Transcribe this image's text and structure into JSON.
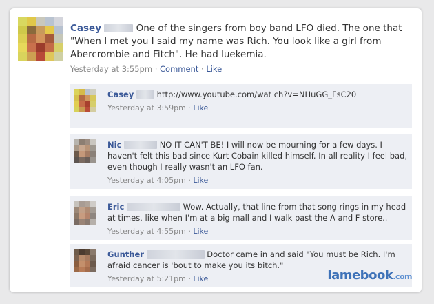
{
  "post": {
    "author": "Casey",
    "text": "One of the singers from boy band LFO died. The one that \"When I met you I said my name was Rich. You look like a girl from Abercrombie and Fitch\". He had luekemia.",
    "timestamp": "Yesterday at 3:55pm",
    "comment_label": "Comment",
    "like_label": "Like",
    "separator": "·"
  },
  "comments": [
    {
      "author": "Casey",
      "text": "http://www.youtube.com/wat ch?v=NHuGG_FsC20",
      "timestamp": "Yesterday at 3:59pm",
      "like_label": "Like"
    },
    {
      "author": "Nic",
      "text": "NO IT CAN'T BE! I will now be mourning for a few days. I haven't felt this bad since Kurt Cobain killed himself. In all reality I feel bad, even though I really wasn't an LFO fan.",
      "timestamp": "Yesterday at 4:05pm",
      "like_label": "Like"
    },
    {
      "author": "Eric",
      "text": "Wow. Actually, that line from that song rings in my head at times, like when I'm at a big mall and I walk past the A and F store..",
      "timestamp": "Yesterday at 4:55pm",
      "like_label": "Like"
    },
    {
      "author": "Gunther",
      "text": "Doctor came in and said \"You must be Rich. I'm afraid cancer is 'bout to make you its bitch.\"",
      "timestamp": "Yesterday at 5:21pm",
      "like_label": "Like"
    }
  ],
  "watermark": {
    "brand": "lamebook",
    "suffix": ".com"
  },
  "colors": {
    "link": "#3b5998",
    "comment_bg": "#edeff4",
    "watermark": "#3e72b8"
  }
}
